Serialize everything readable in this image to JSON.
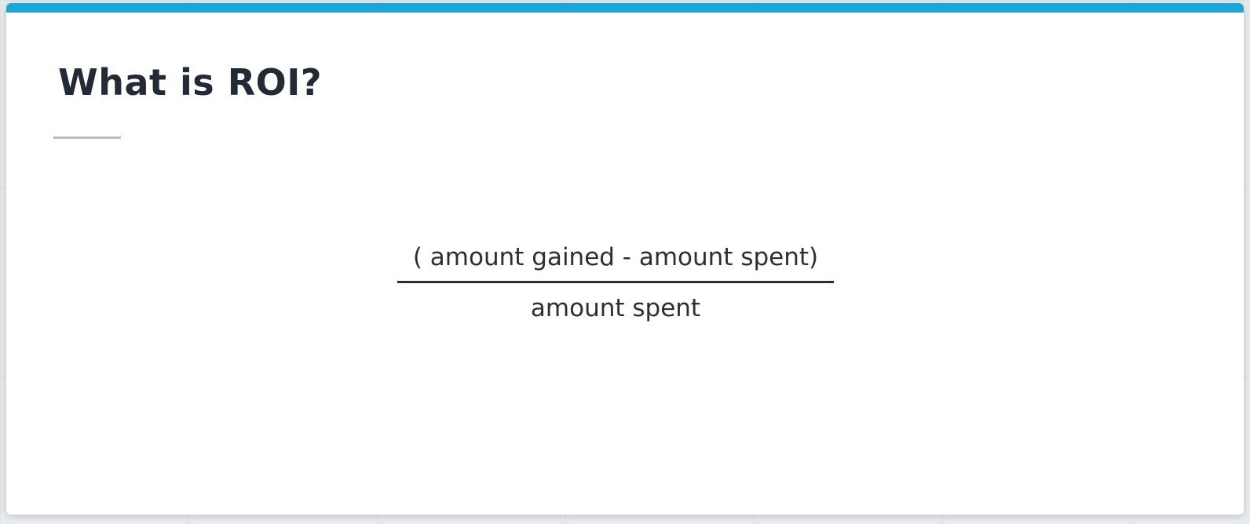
{
  "slide": {
    "title": "What is ROI?",
    "accent_color": "#1aa6d9",
    "formula": {
      "numerator": "( amount gained - amount spent)",
      "denominator": "amount spent"
    }
  }
}
